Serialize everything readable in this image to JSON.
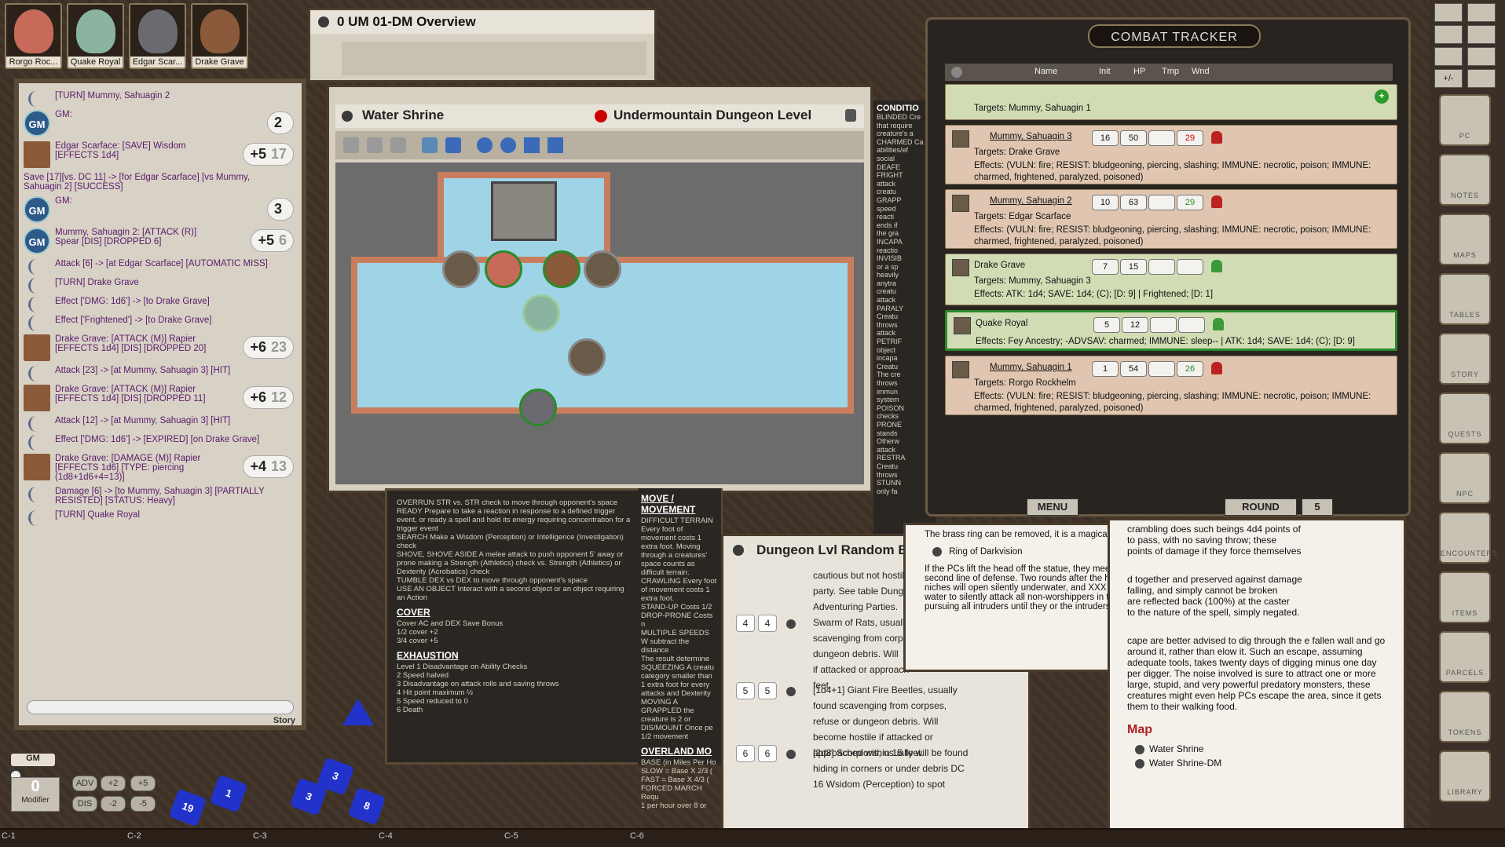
{
  "portraits": [
    {
      "name": "Rorgo Roc...",
      "color": "#c86a5a"
    },
    {
      "name": "Quake Royal",
      "color": "#8ab4a0"
    },
    {
      "name": "Edgar Scar...",
      "color": "#6a6a70"
    },
    {
      "name": "Drake Grave",
      "color": "#8a5a3a"
    }
  ],
  "chat": {
    "messages": [
      {
        "kind": "line",
        "text": "[TURN] Mummy, Sahuagin 2"
      },
      {
        "kind": "gm",
        "text": "GM:",
        "roll": "2",
        "total": ""
      },
      {
        "kind": "portrait",
        "text": "Edgar Scarface: [SAVE] Wisdom [EFFECTS 1d4]",
        "roll": "+5",
        "total": "17"
      },
      {
        "kind": "plain",
        "text": "Save [17][vs. DC 11] -> [for Edgar Scarface] [vs Mummy, Sahuagin 2] [SUCCESS]"
      },
      {
        "kind": "gm",
        "text": "GM:",
        "roll": "3",
        "total": ""
      },
      {
        "kind": "gm",
        "text": "Mummy, Sahuagin 2: [ATTACK (R)] Spear [DIS] [DROPPED 6]",
        "roll": "+5",
        "total": "6"
      },
      {
        "kind": "line",
        "text": "Attack [6] -> [at Edgar Scarface] [AUTOMATIC MISS]"
      },
      {
        "kind": "line",
        "text": "[TURN] Drake Grave"
      },
      {
        "kind": "line",
        "text": "Effect ['DMG: 1d6'] -> [to Drake Grave]"
      },
      {
        "kind": "line",
        "text": "Effect ['Frightened'] -> [to Drake Grave]"
      },
      {
        "kind": "portrait",
        "text": "Drake Grave: [ATTACK (M)] Rapier [EFFECTS 1d4] [DIS] [DROPPED 20]",
        "roll": "+6",
        "total": "23"
      },
      {
        "kind": "line",
        "text": "Attack [23] -> [at Mummy, Sahuagin 3] [HIT]"
      },
      {
        "kind": "portrait",
        "text": "Drake Grave: [ATTACK (M)] Rapier [EFFECTS 1d4] [DIS] [DROPPED 11]",
        "roll": "+6",
        "total": "12"
      },
      {
        "kind": "line",
        "text": "Attack [12] -> [at Mummy, Sahuagin 3] [HIT]"
      },
      {
        "kind": "line",
        "text": "Effect ['DMG: 1d6'] -> [EXPIRED] [on Drake Grave]"
      },
      {
        "kind": "portrait",
        "text": "Drake Grave: [DAMAGE (M)] Rapier [EFFECTS 1d6] [TYPE: piercing (1d8+1d6+4=13)]",
        "roll": "+4",
        "total": "13"
      },
      {
        "kind": "line",
        "text": "Damage [6] -> [to Mummy, Sahuagin 3] [PARTIALLY RESISTED] [STATUS: Heavy]"
      },
      {
        "kind": "line",
        "text": "[TURN] Quake Royal"
      }
    ],
    "story_label": "Story"
  },
  "controls": {
    "gm_label": "GM",
    "modifier_value": "0",
    "modifier_label": "Modifier",
    "buttons": [
      "ADV",
      "+2",
      "+5",
      "DIS",
      "-2",
      "-5"
    ],
    "dice": [
      "19",
      "1",
      "3",
      "3",
      "8"
    ]
  },
  "overview": {
    "title": "0 UM 01-DM Overview"
  },
  "map": {
    "title": "Water Shrine",
    "subtitle": "Undermountain Dungeon Level"
  },
  "reference": {
    "left_lines": [
      "OVERRUN STR vs. STR check to move through opponent's space",
      "READY Prepare to take a reaction in response to a defined trigger event, or ready a spell and hold its energy requiring concentration for a trigger event",
      "SEARCH Make a Wisdom (Perception) or Intelligence (Investigation) check",
      "SHOVE, SHOVE ASIDE A melee attack to push opponent 5' away or prone making a Strength (Athletics) check vs. Strength (Athletics) or Dexterity (Acrobatics) check",
      "TUMBLE DEX vs DEX to move through opponent's space",
      "USE AN OBJECT Interact with a second object or an object requiring an Action"
    ],
    "cover_title": "COVER",
    "cover_header": "Cover        AC and DEX Save Bonus",
    "cover_rows": [
      "1/2 cover     +2",
      "3/4 cover     +5"
    ],
    "exhaustion_title": "EXHAUSTION",
    "exhaustion_rows": [
      "Level 1   Disadvantage on Ability Checks",
      "2   Speed halved",
      "3   Disadvantage on attack rolls and saving throws",
      "4   Hit point maximum ½",
      "5   Speed reduced to 0",
      "6   Death"
    ],
    "move_title": "MOVE / MOVEMENT",
    "move_lines": [
      "DIFFICULT TERRAIN Every foot of movement costs 1 extra foot. Moving through a creatures' space counts as difficult terrain.",
      "CRAWLING Every foot of movement costs 1 extra foot.",
      "STAND-UP Costs 1/2",
      "DROP-PRONE Costs n",
      "MULTIPLE SPEEDS W subtract the distance",
      "The result determine",
      "SQUEEZING A creatu category smaller than",
      "1 extra foot for every",
      "attacks and Dexterity",
      "MOVING A GRAPPLED the creature is 2 or",
      "DIS/MOUNT Once pe",
      "1/2 movement"
    ],
    "overland_title": "OVERLAND MO",
    "overland_lines": [
      "BASE (in Miles Per Ho",
      "SLOW = Base X 2/3 (",
      "FAST = Base X 4/3 (",
      "FORCED MARCH Requ",
      "1 per hour over 8 or"
    ]
  },
  "conditions": {
    "title": "CONDITIO",
    "lines": [
      "BLINDED Cre",
      "that require",
      "creature's a",
      "CHARMED Ca",
      "abilities/ef",
      "social",
      "DEAFE",
      "FRIGHT",
      "attack",
      "creatu",
      "GRAPP",
      "speed",
      "reacti",
      "ends if",
      "the gra",
      "INCAPA",
      "reactio",
      "INVISIB",
      "or a sp",
      "heavily",
      "anytra",
      "creatu",
      "attack",
      "PARALY",
      "Creatu",
      "throws",
      "attack",
      "PETRIF",
      "object",
      "incapa",
      "Creatu",
      "The cre",
      "throws",
      "immun",
      "system",
      "POISON",
      "checks",
      "PRONE",
      "stands",
      "Otherw",
      "attack",
      "RESTRA",
      "Creatu",
      "throws",
      "STUNN",
      "only fa"
    ]
  },
  "random": {
    "title": "Dungeon Lvl Random En",
    "intro": [
      "cautious but not hostile",
      "party. See table Dunge",
      "Adventuring Parties."
    ],
    "rows": [
      {
        "a": "4",
        "b": "4",
        "lines": [
          "Swarm of Rats, usually",
          "scavenging from corps",
          "dungeon debris. Will",
          "if attacked or approach",
          "feet."
        ]
      },
      {
        "a": "5",
        "b": "5",
        "lines": [
          "[1d4+1] Giant Fire Beetles, usually",
          "found scavenging from corpses,",
          "refuse or dungeon debris. Will",
          "become hostile if attacked or",
          "approached within 15 feet."
        ]
      },
      {
        "a": "6",
        "b": "6",
        "lines": [
          "[2d8] Scorpions, usually will be found",
          "hiding in corners or under debris DC",
          "16 Wsidom (Perception) to spot"
        ]
      }
    ]
  },
  "story1": {
    "line1": "The brass ring can be removed, it is a magical ring;",
    "link": "Ring of Darkvision",
    "para": "If the PCs lift the head off the statue, they meet the temple's second line of defense. Two rounds after the head is removed, niches will open silently underwater, and XXX rise up from the water to silently attack all non-worshippers in the chamber, pursuing all intruders until they or the intruders are destroyed."
  },
  "story2": {
    "top_lines": [
      "crambling does such beings 4d4 points of",
      "to pass, with no saving throw; these",
      "points of damage if they force themselves"
    ],
    "mid_lines": [
      "d together and preserved against damage",
      "falling, and simply cannot be broken",
      "are reflected back (100%) at the caster",
      "to the nature of the spell, simply negated."
    ],
    "para": "cape are better advised to dig through the e fallen wall and go around it, rather than elow it. Such an escape, assuming adequate tools, takes twenty days of digging minus one day per digger. The noise involved is sure to attract one or more large, stupid, and very powerful predatory monsters, these creatures might even help PCs escape the area, since it gets them to their walking food.",
    "map_title": "Map",
    "links": [
      "Water Shrine",
      "Water Shrine-DM"
    ]
  },
  "combat": {
    "title": "COMBAT TRACKER",
    "headers": {
      "name": "Name",
      "init": "Init",
      "hp": "HP",
      "tmp": "Tmp",
      "wnd": "Wnd"
    },
    "top_target": "Targets: Mummy, Sahuagin 1",
    "rows": [
      {
        "name": "Mummy, Sahuagin 3",
        "init": "16",
        "hp": "50",
        "tmp": "",
        "wnd": "29",
        "side": "enemy",
        "targets": "Targets: Drake Grave",
        "effects": "Effects: (VULN: fire; RESIST: bludgeoning, piercing, slashing; IMMUNE: necrotic, poison; IMMUNE: charmed, frightened, paralyzed, poisoned)"
      },
      {
        "name": "Mummy, Sahuagin 2",
        "init": "10",
        "hp": "63",
        "tmp": "",
        "wnd": "29",
        "side": "enemy",
        "targets": "Targets: Edgar Scarface",
        "effects": "Effects: (VULN: fire; RESIST: bludgeoning, piercing, slashing; IMMUNE: necrotic, poison; IMMUNE: charmed, frightened, paralyzed, poisoned)"
      },
      {
        "name": "Drake Grave",
        "init": "7",
        "hp": "15",
        "tmp": "",
        "wnd": "",
        "side": "friend",
        "targets": "Targets: Mummy, Sahuagin 3",
        "effects": "Effects: ATK: 1d4; SAVE: 1d4; (C); [D: 9] | Frightened; [D: 1]"
      },
      {
        "name": "Quake Royal",
        "init": "5",
        "hp": "12",
        "tmp": "",
        "wnd": "",
        "side": "friend",
        "targets": "",
        "effects": "Effects: Fey Ancestry; -ADVSAV: charmed; IMMUNE: sleep-- | ATK: 1d4; SAVE: 1d4; (C); [D: 9]"
      },
      {
        "name": "Mummy, Sahuagin 1",
        "init": "1",
        "hp": "54",
        "tmp": "",
        "wnd": "26",
        "side": "enemy",
        "targets": "Targets: Rorgo Rockhelm",
        "effects": "Effects: (VULN: fire; RESIST: bludgeoning, piercing, slashing; IMMUNE: necrotic, poison; IMMUNE: charmed, frightened, paralyzed, poisoned)"
      }
    ],
    "menu_label": "MENU",
    "round_label": "ROUND",
    "round_value": "5"
  },
  "sidebar": {
    "top_buttons": [
      "+/-"
    ],
    "items": [
      "PC",
      "NOTES",
      "MAPS",
      "TABLES",
      "STORY",
      "QUESTS",
      "NPC",
      "ENCOUNTERS",
      "ITEMS",
      "PARCELS",
      "TOKENS",
      "LIBRARY"
    ]
  },
  "hotkeys": [
    "C-1",
    "C-2",
    "C-3",
    "C-4",
    "C-5",
    "C-6"
  ]
}
